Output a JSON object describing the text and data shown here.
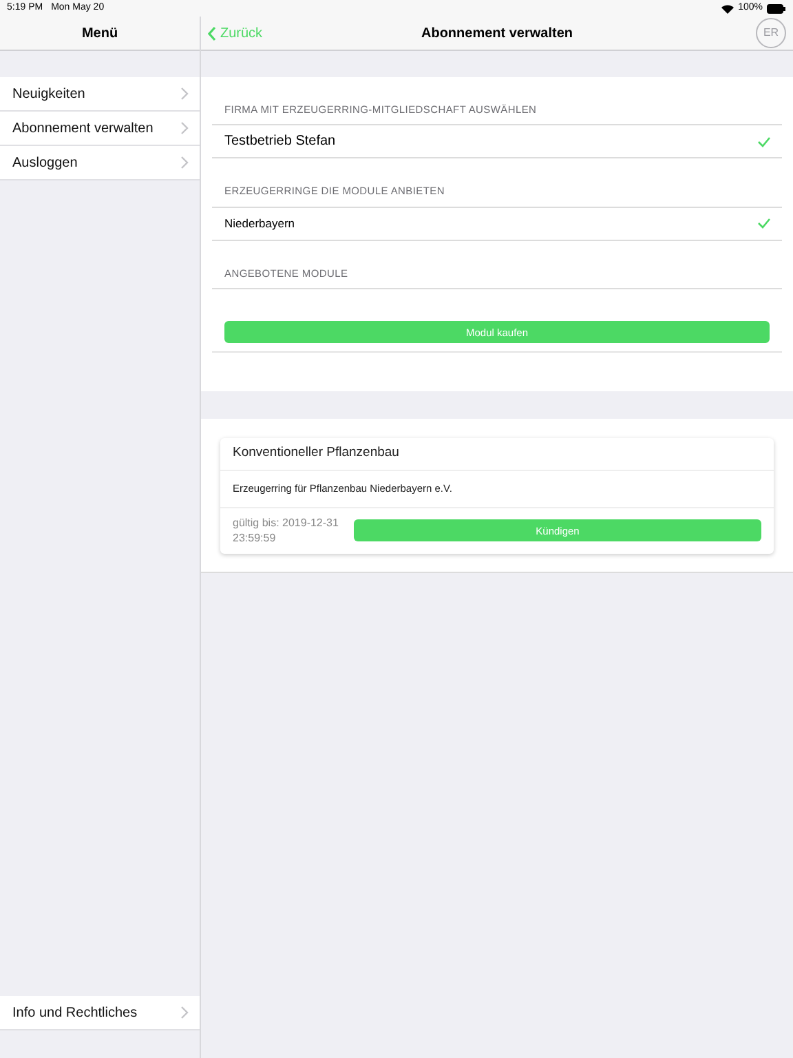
{
  "status_bar": {
    "time": "5:19 PM",
    "date": "Mon May 20",
    "battery": "100%"
  },
  "sidebar": {
    "title": "Menü",
    "items": [
      {
        "label": "Neuigkeiten"
      },
      {
        "label": "Abonnement verwalten"
      },
      {
        "label": "Ausloggen"
      }
    ],
    "bottom_item": {
      "label": "Info und Rechtliches"
    }
  },
  "nav": {
    "back": "Zurück",
    "title": "Abonnement verwalten",
    "logo": "ER"
  },
  "sections": [
    {
      "header": "FIRMA MIT ERZEUGERRING-MITGLIEDSCHAFT AUSWÄHLEN",
      "rows": [
        {
          "label": "Testbetrieb Stefan",
          "checked": true,
          "large": true
        }
      ]
    },
    {
      "header": "ERZEUGERRINGE DIE MODULE ANBIETEN",
      "rows": [
        {
          "label": "Niederbayern",
          "checked": true,
          "large": false
        }
      ]
    },
    {
      "header": "ANGEBOTENE MODULE"
    }
  ],
  "buy_button": "Modul kaufen",
  "subscription": {
    "title": "Konventioneller Pflanzenbau",
    "provider": "Erzeugerring für Pflanzenbau Niederbayern e.V.",
    "valid_until": "gültig bis: 2019-12-31 23:59:59",
    "cancel_button": "Kündigen"
  }
}
